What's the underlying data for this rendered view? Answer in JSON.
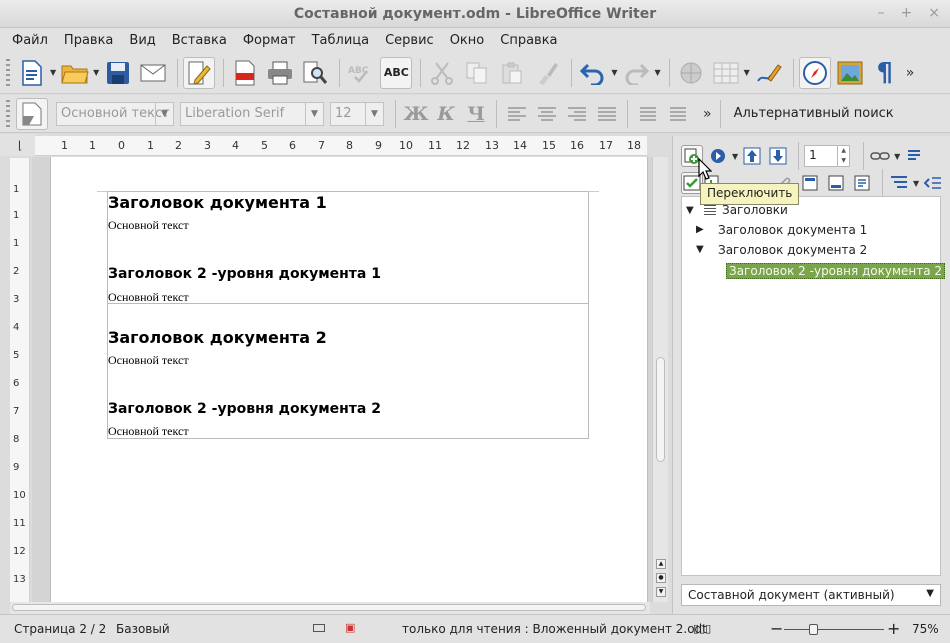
{
  "window": {
    "title": "Составной документ.odm - LibreOffice Writer",
    "buttons": [
      "–",
      "+",
      "×"
    ]
  },
  "menu": [
    "Файл",
    "Правка",
    "Вид",
    "Вставка",
    "Формат",
    "Таблица",
    "Сервис",
    "Окно",
    "Справка"
  ],
  "toolbar": {
    "spell_label": "ABC",
    "paragraph_mark": "¶"
  },
  "formatting": {
    "paragraph_style": "Основной текст",
    "font_name": "Liberation Serif",
    "font_size": "12",
    "bold": "Ж",
    "italic": "К",
    "underline": "Ч",
    "more": "»",
    "alt_search": "Альтернативный поиск"
  },
  "ruler": {
    "h_ticks": [
      "1",
      "1",
      "0",
      "1",
      "2",
      "3",
      "4",
      "5",
      "6",
      "7",
      "8",
      "9",
      "10",
      "11",
      "12",
      "13",
      "14",
      "15",
      "16",
      "17",
      "18",
      "19"
    ],
    "v_ticks": [
      "1",
      "1",
      "1",
      "2",
      "3",
      "4",
      "5",
      "6",
      "7",
      "8",
      "9",
      "10",
      "11",
      "12",
      "13"
    ]
  },
  "document": {
    "doc1_heading": "Заголовок документа 1",
    "doc1_body1": "Основной текст",
    "doc1_subheading": "Заголовок 2 -уровня документа 1",
    "doc1_body2": "Основной текст",
    "doc2_heading": "Заголовок документа 2",
    "doc2_body1": "Основной текст",
    "doc2_subheading": "Заголовок 2 -уровня документа 2",
    "doc2_body2": "Основной текст"
  },
  "navigator": {
    "page_number": "1",
    "tooltip": "Переключить",
    "tree": {
      "root": "Заголовки",
      "item1": "Заголовок документа 1",
      "item2": "Заголовок документа 2",
      "item2_child": "Заголовок 2 -уровня документа 2"
    },
    "document_select": "Составной документ (активный)"
  },
  "status": {
    "page": "Страница 2 / 2",
    "page_style": "Базовый",
    "readonly": "только для чтения : Вложенный документ 2.odt",
    "zoom": "75%",
    "zoom_fraction": 0.29
  },
  "colors": {
    "accent": "#2a5fa8",
    "tree_selection": "#7aa54a",
    "tooltip_bg": "#f7f3bf"
  }
}
